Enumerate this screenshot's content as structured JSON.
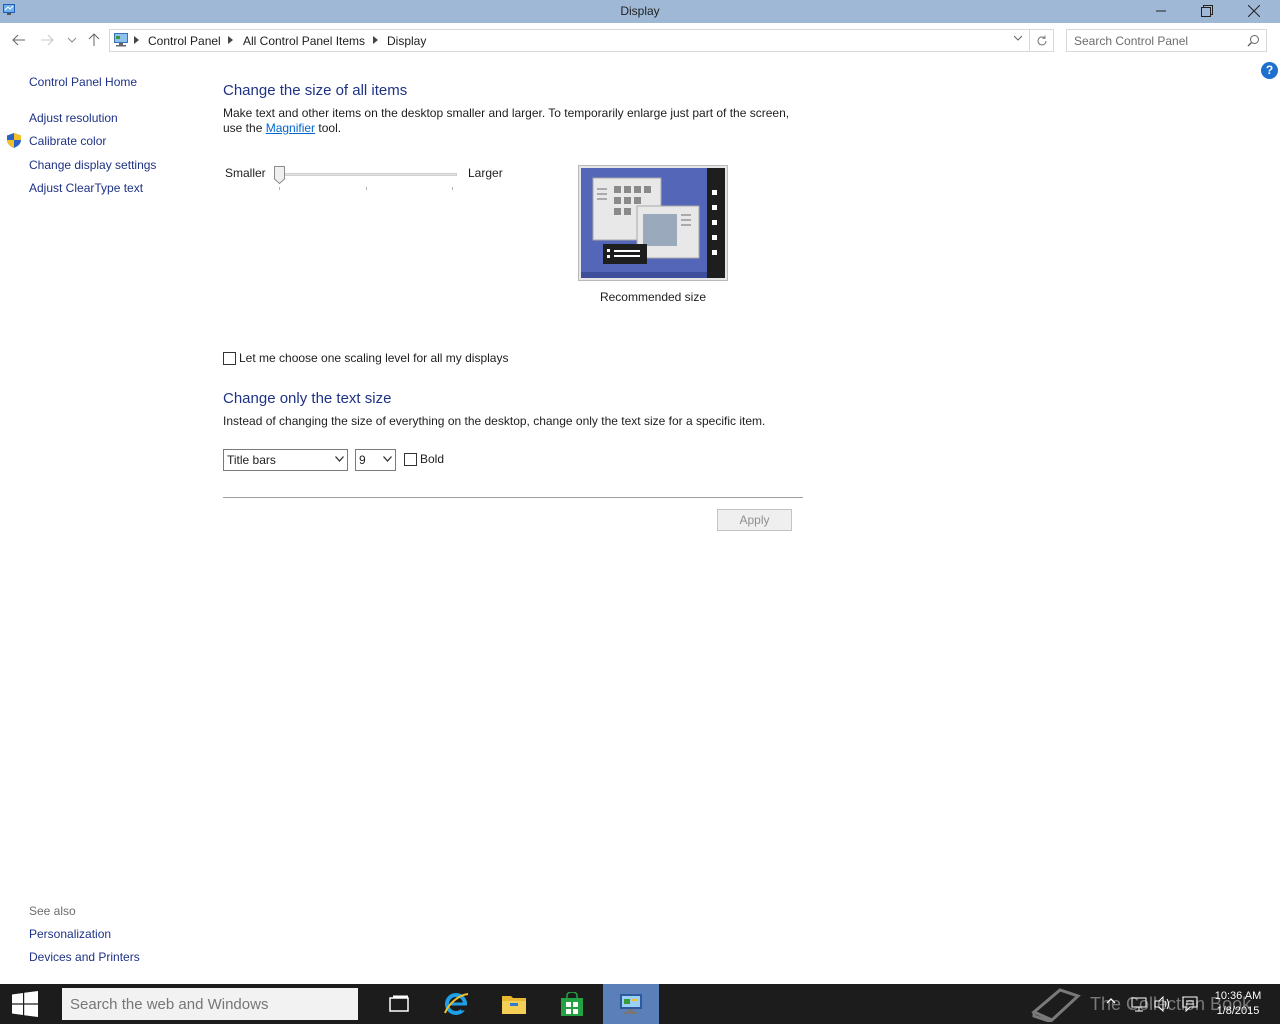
{
  "window": {
    "title": "Display"
  },
  "address": {
    "crumbs": [
      "Control Panel",
      "All Control Panel Items",
      "Display"
    ],
    "search_placeholder": "Search Control Panel"
  },
  "help_label": "?",
  "leftnav": {
    "home": "Control Panel Home",
    "items": [
      "Adjust resolution",
      "Calibrate color",
      "Change display settings",
      "Adjust ClearType text"
    ]
  },
  "see_also": {
    "heading": "See also",
    "items": [
      "Personalization",
      "Devices and Printers"
    ]
  },
  "main": {
    "size_heading": "Change the size of all items",
    "size_desc_line1": "Make text and other items on the desktop smaller and larger. To temporarily enlarge just part of the screen,",
    "size_desc_line2_pre": "use the ",
    "magnifier_link": "Magnifier",
    "size_desc_line2_post": " tool.",
    "slider": {
      "min_label": "Smaller",
      "max_label": "Larger",
      "value_fraction": 0.0
    },
    "preview_caption": "Recommended size",
    "scaling_checkbox_label": "Let me choose one scaling level for all my displays",
    "scaling_checked": false,
    "text_heading": "Change only the text size",
    "text_desc": "Instead of changing the size of everything on the desktop, change only the text size for a specific item.",
    "item_select": "Title bars",
    "size_select": "9",
    "bold_label": "Bold",
    "bold_checked": false,
    "apply_label": "Apply"
  },
  "taskbar": {
    "search_placeholder": "Search the web and Windows",
    "watermark": "The Collection Book",
    "time": "10:36 AM",
    "date": "1/8/2015"
  },
  "colors": {
    "titlebar": "#9fb8d6",
    "heading": "#1e3287",
    "link": "#0066cc",
    "taskbar": "#1c1c1c",
    "active_task": "#5a7fb9"
  }
}
